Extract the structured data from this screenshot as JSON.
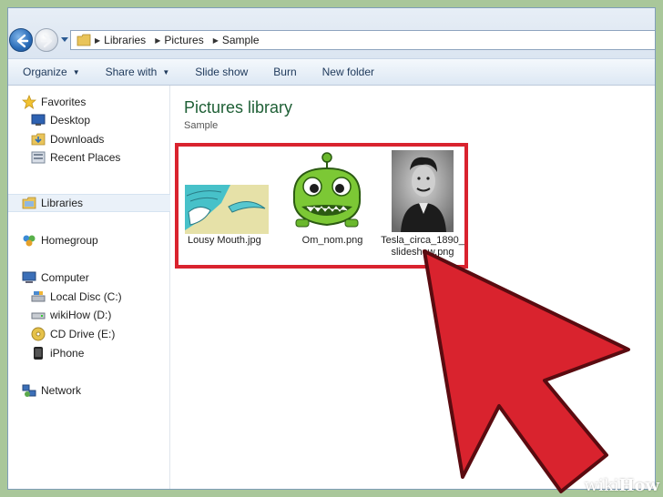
{
  "address": {
    "crumbs": [
      "Libraries",
      "Pictures",
      "Sample"
    ]
  },
  "toolbar": {
    "organize": "Organize",
    "share_with": "Share with",
    "slide_show": "Slide show",
    "burn": "Burn",
    "new_folder": "New folder"
  },
  "nav": {
    "favorites": "Favorites",
    "desktop": "Desktop",
    "downloads": "Downloads",
    "recent_places": "Recent Places",
    "libraries": "Libraries",
    "homegroup": "Homegroup",
    "computer": "Computer",
    "local_disc": "Local Disc (C:)",
    "wikihow_drive": "wikiHow (D:)",
    "cd_drive": "CD Drive (E:)",
    "iphone": "iPhone",
    "network": "Network"
  },
  "content": {
    "title": "Pictures library",
    "subtitle": "Sample",
    "files": [
      {
        "name": "Lousy Mouth.jpg"
      },
      {
        "name": "Om_nom.png"
      },
      {
        "name_line1": "Tesla_circa_1890_",
        "name_line2": "slideshow.png"
      }
    ]
  },
  "colors": {
    "highlight_red": "#d9232e",
    "title_green": "#1e5f35",
    "background_green": "#a9c79a"
  },
  "watermark": {
    "wiki": "wiki",
    "how": "How"
  }
}
